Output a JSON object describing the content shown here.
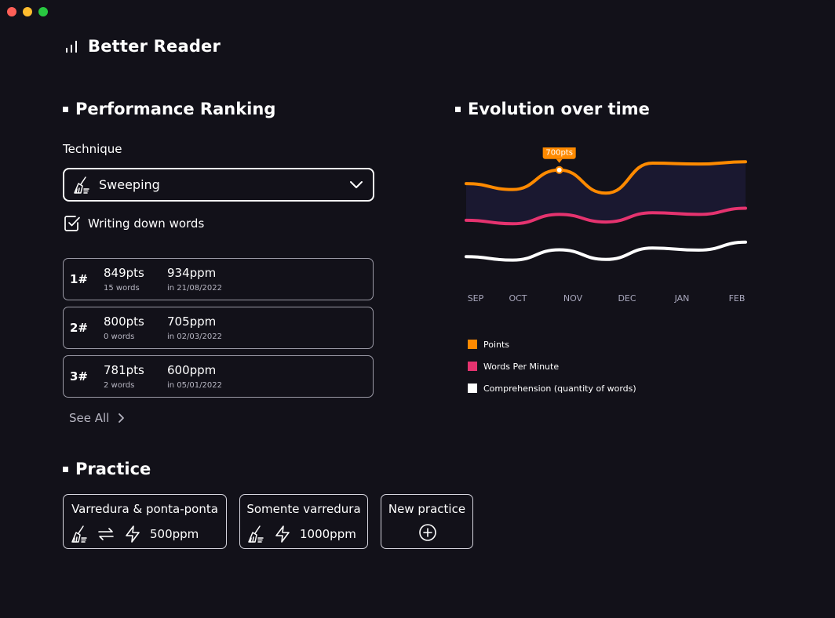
{
  "app": {
    "title": "Better Reader"
  },
  "sections": {
    "ranking": "Performance Ranking",
    "evolution": "Evolution over time",
    "practice": "Practice"
  },
  "technique": {
    "label": "Technique",
    "selected": "Sweeping",
    "icon": "broom-icon"
  },
  "checkbox": {
    "label": "Writing down words",
    "checked": true
  },
  "rankings": [
    {
      "position": "1#",
      "points": "849pts",
      "words": "15 words",
      "ppm": "934ppm",
      "date": "in 21/08/2022"
    },
    {
      "position": "2#",
      "points": "800pts",
      "words": "0 words",
      "ppm": "705ppm",
      "date": "in 02/03/2022"
    },
    {
      "position": "3#",
      "points": "781pts",
      "words": "2 words",
      "ppm": "600ppm",
      "date": "in 05/01/2022"
    }
  ],
  "see_all": "See All",
  "practice": [
    {
      "title": "Varredura & ponta-ponta",
      "value": "500ppm",
      "icons": [
        "broom-icon",
        "swap-arrows-icon",
        "lightning-icon"
      ]
    },
    {
      "title": "Somente varredura",
      "value": "1000ppm",
      "icons": [
        "broom-icon",
        "lightning-icon"
      ]
    },
    {
      "title": "New practice",
      "icon": "plus-circle-icon"
    }
  ],
  "chart_data": {
    "type": "line",
    "categories": [
      "SEP",
      "OCT",
      "NOV",
      "DEC",
      "JAN",
      "FEB"
    ],
    "tooltip": {
      "label": "700pts",
      "series": "Points"
    },
    "series": [
      {
        "name": "Points",
        "color": "#ff8a00",
        "values": [
          0.55,
          0.42,
          0.85,
          0.34,
          1.0,
          0.98,
          1.03
        ]
      },
      {
        "name": "Words Per Minute",
        "color": "#e5336f",
        "values": [
          0.48,
          0.38,
          0.65,
          0.43,
          0.7,
          0.65,
          0.83
        ]
      },
      {
        "name": "Comprehension (quantity of words)",
        "color": "#ffffff",
        "values": [
          0.38,
          0.28,
          0.58,
          0.3,
          0.63,
          0.57,
          0.8
        ]
      }
    ]
  }
}
